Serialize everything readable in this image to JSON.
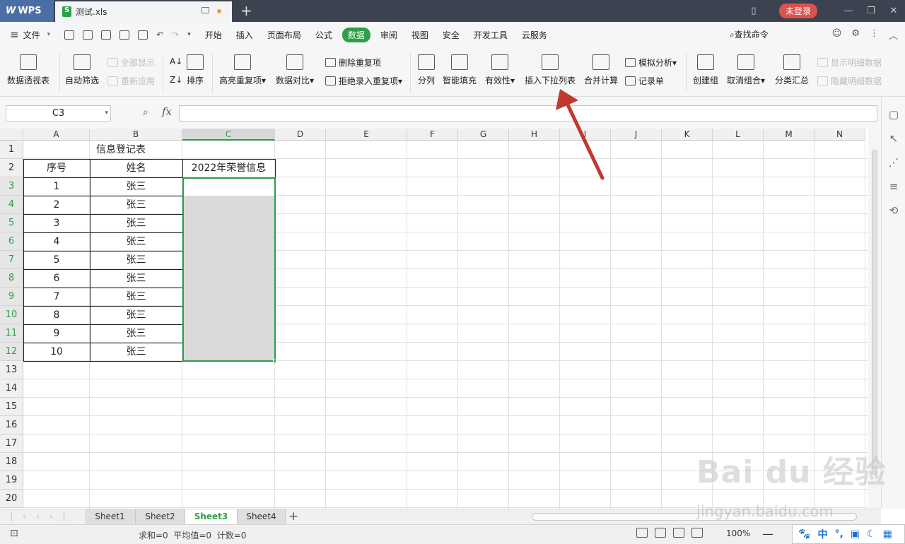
{
  "app": {
    "name": "WPS",
    "file_tab": "测试.xls",
    "login": "未登录"
  },
  "menu": {
    "file": "文件",
    "tabs": [
      "开始",
      "插入",
      "页面布局",
      "公式",
      "数据",
      "审阅",
      "视图",
      "安全",
      "开发工具",
      "云服务"
    ],
    "active": "数据",
    "search": "查找命令"
  },
  "ribbon": {
    "pivot": "数据透视表",
    "autofilter": "自动筛选",
    "show_all": "全部显示",
    "reapply": "重新应用",
    "sort": "排序",
    "highlight_dup": "高亮重复项",
    "compare": "数据对比",
    "delete_dup": "删除重复项",
    "reject_dup": "拒绝录入重复项",
    "split": "分列",
    "smart_fill": "智能填充",
    "validity": "有效性",
    "insert_dropdown": "插入下拉列表",
    "merge_calc": "合并计算",
    "simulate": "模拟分析",
    "record": "记录单",
    "create_group": "创建组",
    "ungroup": "取消组合",
    "subtotal": "分类汇总",
    "show_detail": "显示明细数据",
    "hide_detail": "隐藏明细数据"
  },
  "formula_bar": {
    "name_box": "C3",
    "fx": "fx",
    "value": ""
  },
  "columns": [
    "A",
    "B",
    "C",
    "D",
    "E",
    "F",
    "G",
    "H",
    "I",
    "J",
    "K",
    "L",
    "M",
    "N"
  ],
  "selected_column": "C",
  "rows": [
    "1",
    "2",
    "3",
    "4",
    "5",
    "6",
    "7",
    "8",
    "9",
    "10",
    "11",
    "12",
    "13",
    "14",
    "15",
    "16",
    "17",
    "18",
    "19",
    "20"
  ],
  "sheet": {
    "title": "信息登记表",
    "headers": {
      "a": "序号",
      "b": "姓名",
      "c": "2022年荣誉信息"
    },
    "records": [
      {
        "no": "1",
        "name": "张三"
      },
      {
        "no": "2",
        "name": "张三"
      },
      {
        "no": "3",
        "name": "张三"
      },
      {
        "no": "4",
        "name": "张三"
      },
      {
        "no": "5",
        "name": "张三"
      },
      {
        "no": "6",
        "name": "张三"
      },
      {
        "no": "7",
        "name": "张三"
      },
      {
        "no": "8",
        "name": "张三"
      },
      {
        "no": "9",
        "name": "张三"
      },
      {
        "no": "10",
        "name": "张三"
      }
    ]
  },
  "sheet_tabs": [
    "Sheet1",
    "Sheet2",
    "Sheet3",
    "Sheet4"
  ],
  "active_sheet": "Sheet3",
  "status": {
    "sum": "求和=0",
    "avg": "平均值=0",
    "count": "计数=0",
    "zoom": "100%"
  },
  "ime": {
    "lang": "中"
  },
  "watermark": {
    "logo": "Bai du 经验",
    "url": "jingyan.baidu.com"
  },
  "colors": {
    "accent": "#2e9e48",
    "arrow": "#c0392b",
    "login": "#d9534f"
  }
}
